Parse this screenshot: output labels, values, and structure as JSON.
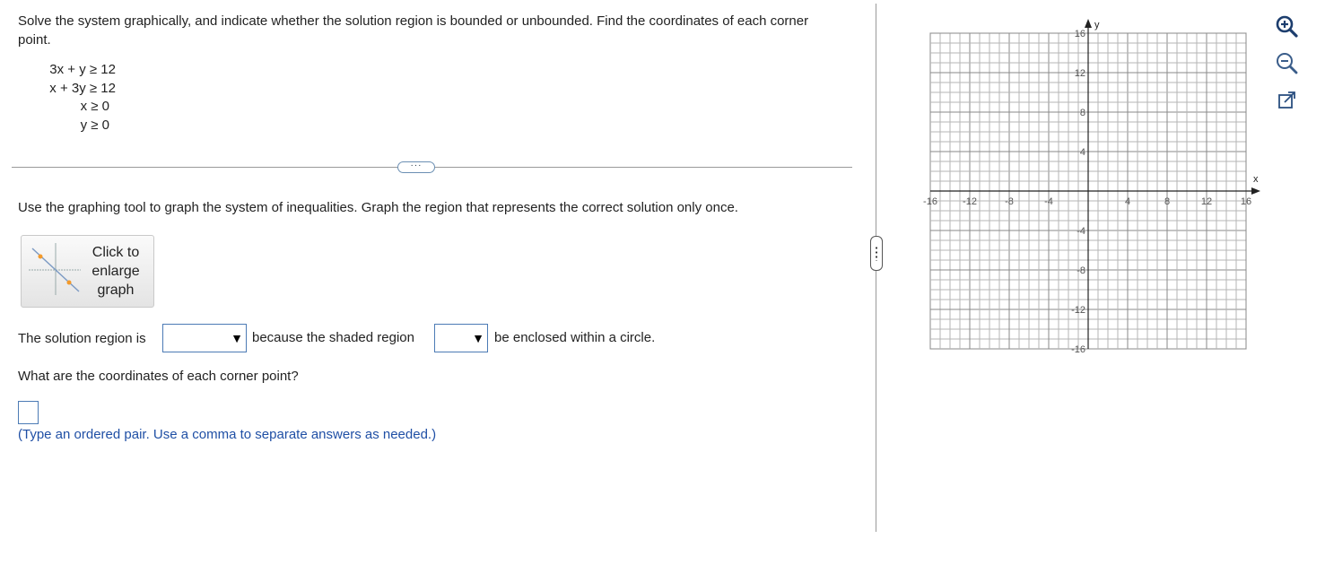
{
  "problem": {
    "prompt": "Solve the system graphically, and indicate whether the solution region is bounded or unbounded. Find the coordinates of each corner point.",
    "inequalities": [
      "3x + y ≥ 12",
      "x + 3y ≥ 12",
      "x ≥ 0",
      "y ≥ 0"
    ]
  },
  "more_button": "···",
  "instruction": "Use the graphing tool to graph the system of inequalities. Graph the region that represents the correct solution only once.",
  "enlarge_button": {
    "label": "Click to enlarge graph"
  },
  "answer_sentence": {
    "prefix": "The solution region is",
    "middle": "because the shaded region",
    "suffix": "be enclosed within a circle.",
    "select1_value": "",
    "select2_value": "",
    "arrow": "▼"
  },
  "question": "What are the coordinates of each corner point?",
  "corner_answer_value": "",
  "hint": "(Type an ordered pair. Use a comma to separate answers as needed.)",
  "graph": {
    "x_label": "x",
    "y_label": "y",
    "x_ticks": [
      "-16",
      "-12",
      "-8",
      "-4",
      "4",
      "8",
      "12",
      "16"
    ],
    "y_ticks": [
      "16",
      "12",
      "8",
      "4",
      "-4",
      "-8",
      "-12",
      "-16"
    ],
    "range": [
      -16,
      16
    ],
    "grid": true
  },
  "side_icons": [
    "zoom-in-icon",
    "zoom-out-icon",
    "popout-icon"
  ]
}
